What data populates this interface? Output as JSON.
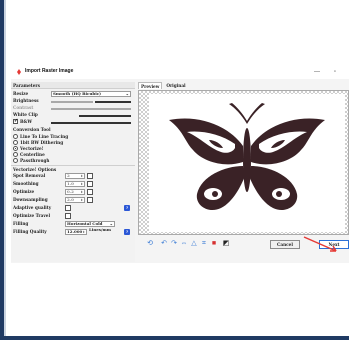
{
  "window": {
    "title": "Import Raster Image",
    "minimize_glyph": "—",
    "maximize_glyph": "▫"
  },
  "params": {
    "header": "Parameters",
    "resize_label": "Resize",
    "resize_value": "Smooth (HQ Bicubic)",
    "brightness_label": "Brightness",
    "contrast_label": "Contrast",
    "white_clip_label": "White Clip",
    "bw_label": "B&W",
    "bw_checked": true
  },
  "conversion": {
    "header": "Conversion Tool",
    "options": [
      {
        "label": "Line To Line Tracing",
        "selected": false
      },
      {
        "label": "1bit BW Dithering",
        "selected": false
      },
      {
        "label": "Vectorize!",
        "selected": true
      },
      {
        "label": "Centerline",
        "selected": false
      },
      {
        "label": "Passthrough",
        "selected": false
      }
    ]
  },
  "vectorize": {
    "header": "Vectorize! Options",
    "spot_removal_label": "Spot Removal",
    "spot_removal_value": "2",
    "smoothing_label": "Smoothing",
    "smoothing_value": "1.0",
    "optimize_label": "Optimize",
    "optimize_value": "0.2",
    "downsampling_label": "Downsampling",
    "downsampling_value": "2.0",
    "adaptive_quality_label": "Adaptive quality",
    "optimize_travel_label": "Optimize Travel",
    "filling_label": "Filling",
    "filling_value": "Horizontal Cold",
    "filling_quality_label": "Filling Quality",
    "filling_quality_value": "12.000",
    "filling_quality_unit": "Lines/mm",
    "help_glyph": "?"
  },
  "preview": {
    "tabs": [
      {
        "label": "Preview",
        "active": true
      },
      {
        "label": "Original",
        "active": false
      }
    ]
  },
  "buttons": {
    "cancel_label": "Cancel",
    "next_label": "Next"
  },
  "colors": {
    "frame": "#1f3a63",
    "butterfly": "#3a2226",
    "accent": "#2b6fd6",
    "arrow": "#e53935"
  }
}
